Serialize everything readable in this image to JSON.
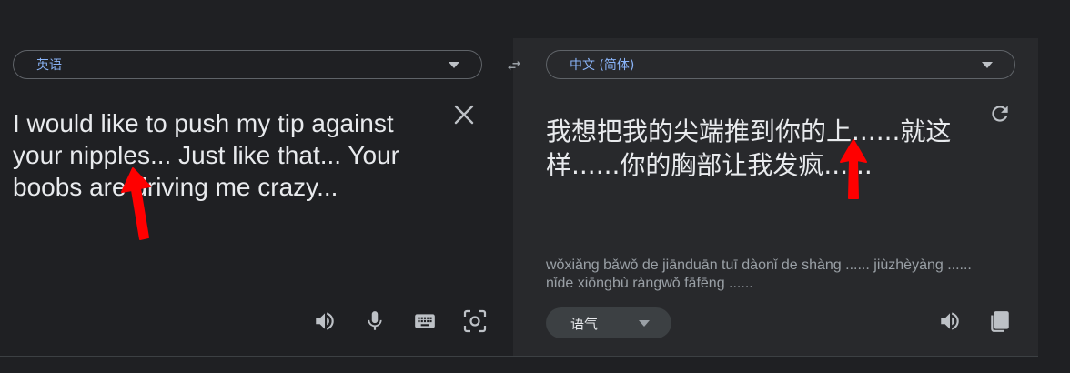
{
  "source": {
    "language": "英语",
    "text": "I would like to push my tip against your nipples... Just like that... Your boobs are driving me crazy..."
  },
  "target": {
    "language": "中文 (简体)",
    "text": "我想把我的尖端推到你的上......就这样......你的胸部让我发疯......",
    "romanization": "wǒxiǎng bǎwǒ de jiānduān tuī dàonǐ de shàng ...... jiùzhèyàng ...... nǐde xiōngbù ràngwǒ fāfēng ......",
    "tone_label": "语气"
  },
  "icons": {
    "swap": "swap-arrows-icon",
    "clear": "close-icon",
    "refresh": "refresh-icon",
    "speaker": "speaker-icon",
    "mic": "microphone-icon",
    "keyboard": "keyboard-icon",
    "camera": "camera-icon",
    "copy": "copy-icon"
  },
  "colors": {
    "background": "#1f2023",
    "target_panel": "#28292c",
    "accent": "#8ab4f8",
    "annotation_arrow": "#ff0000"
  }
}
